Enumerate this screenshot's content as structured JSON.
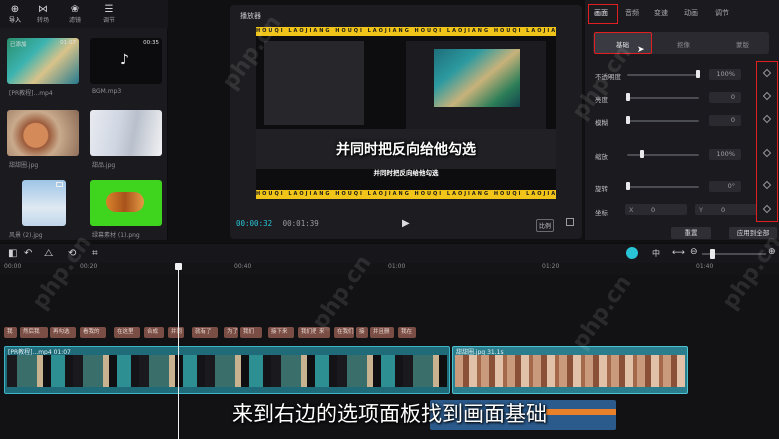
{
  "media_tabs": [
    {
      "label": "导入",
      "icon": "import-icon"
    },
    {
      "label": "转场",
      "icon": "transition-icon"
    },
    {
      "label": "滤镜",
      "icon": "filter-icon"
    },
    {
      "label": "调节",
      "icon": "adjust-icon"
    }
  ],
  "media_items": [
    {
      "label": "[PR教程]...mp4",
      "inner_name": "已添加",
      "duration": "01:07"
    },
    {
      "label": "BGM.mp3",
      "duration": "00:35"
    },
    {
      "label": "甜甜圈.jpg"
    },
    {
      "label": "甜品.jpg"
    },
    {
      "label": "风景 (2).jpg"
    },
    {
      "label": "绿幕素材 (1).png"
    }
  ],
  "player": {
    "title": "播放器",
    "current_time": "00:00:32",
    "total_time": "00:01:39",
    "ratio_label": "比例",
    "video_stripe_text": "HOUQI   LAOJIANG   HOUQI   LAOJIANG   HOUQI   LAOJIANG   HOUQI   LAOJIANG   HOUQI",
    "video_big_text": "并同时把反向给他勾选",
    "video_small_text": "并同时把反向给他勾选"
  },
  "inspector": {
    "tabs": [
      "画面",
      "音频",
      "变速",
      "动画",
      "调节"
    ],
    "subtabs": [
      "基础",
      "抠像",
      "蒙版"
    ],
    "rows": [
      {
        "label": "不透明度",
        "value": "100%",
        "level": 1.0
      },
      {
        "label": "亮度",
        "value": "0",
        "level": 0.0
      },
      {
        "label": "模糊",
        "value": "0",
        "level": 0.0
      },
      {
        "label": "缩放",
        "value": "100%",
        "level": 0.2
      },
      {
        "label": "旋转",
        "value": "0°",
        "level": 0.0
      }
    ],
    "position": {
      "label": "坐标",
      "x_label": "X",
      "x_value": "0",
      "y_label": "Y",
      "y_value": "0"
    },
    "reset_label": "重置",
    "apply_all_label": "应用到全部"
  },
  "toolbar": {
    "split_label": "中"
  },
  "timeline": {
    "ruler": [
      "00:00",
      "00:20",
      "00:40",
      "01:00",
      "01:20",
      "01:40"
    ],
    "subtitles": [
      "我",
      "然后我",
      "再勾选",
      "看我的",
      "在这里",
      "合成",
      "并同",
      "就有了",
      "为了",
      "我们",
      "接下来",
      "我们把",
      "来",
      "在我们",
      "接",
      "并且删",
      "我在"
    ],
    "clip1_label": "[PR教程]...mp4   01:07",
    "clip2_label": "甜甜圈.jpg   31.1s"
  },
  "caption": "来到右边的选项面板找到画面基础",
  "watermark": "php.cn",
  "colors": {
    "accent": "#29c4d6",
    "highlight_box": "#e02020",
    "clip_video": "#1f6b7a",
    "clip_image": "#2a7d8c",
    "subtitle": "#7a4e44"
  }
}
